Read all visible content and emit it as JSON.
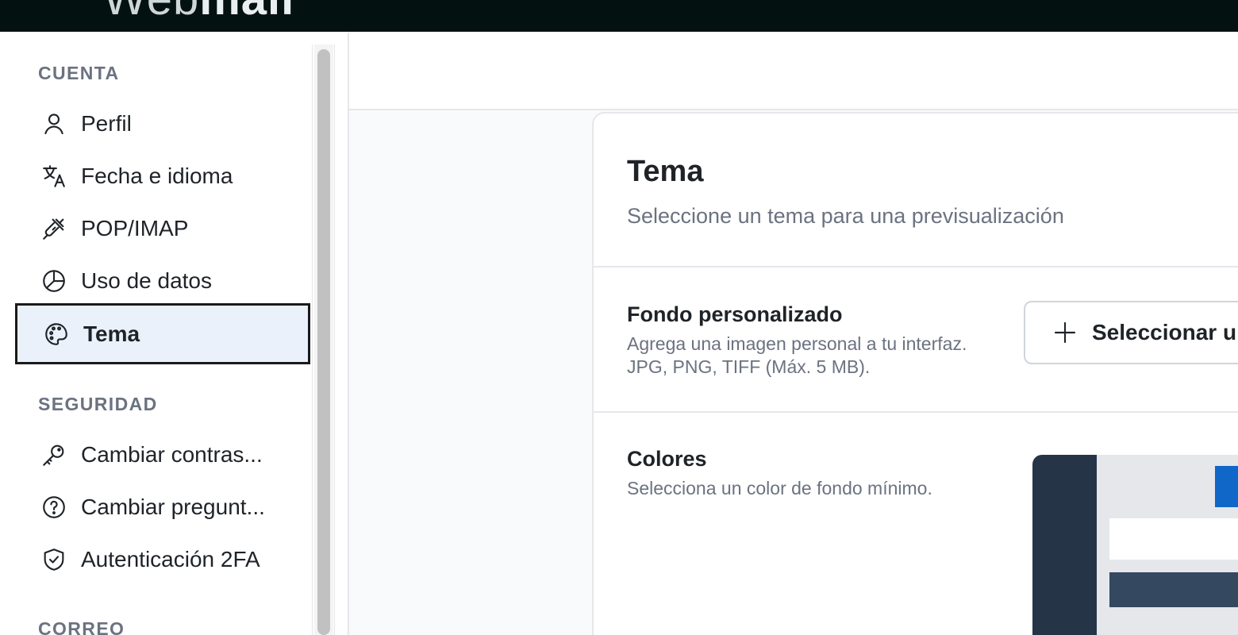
{
  "app": {
    "logo_light": "Web",
    "logo_bold": "mail"
  },
  "sidebar": {
    "sections": [
      {
        "title": "CUENTA",
        "items": [
          {
            "label": "Perfil",
            "icon": "user-icon"
          },
          {
            "label": "Fecha e idioma",
            "icon": "translate-icon"
          },
          {
            "label": "POP/IMAP",
            "icon": "plug-icon"
          },
          {
            "label": "Uso de datos",
            "icon": "pie-chart-icon"
          },
          {
            "label": "Tema",
            "icon": "palette-icon",
            "active": true
          }
        ]
      },
      {
        "title": "SEGURIDAD",
        "items": [
          {
            "label": "Cambiar contras...",
            "icon": "key-icon"
          },
          {
            "label": "Cambiar pregunt...",
            "icon": "question-circle-icon"
          },
          {
            "label": "Autenticación 2FA",
            "icon": "shield-check-icon"
          }
        ]
      },
      {
        "title": "CORREO",
        "items": []
      }
    ]
  },
  "card": {
    "title": "Tema",
    "subtitle": "Seleccione un tema para una previsualización",
    "background_row": {
      "title": "Fondo personalizado",
      "description": "Agrega una imagen personal a tu interfaz. JPG, PNG, TIFF (Máx. 5 MB).",
      "button_label": "Seleccionar u"
    },
    "colors_row": {
      "title": "Colores",
      "description": "Selecciona un color de fondo mínimo."
    }
  },
  "colors": {
    "topbar": "#031110",
    "active_item_bg": "#eaf1fb",
    "preview_sidebar": "#253547",
    "preview_accent": "#1167c7"
  }
}
